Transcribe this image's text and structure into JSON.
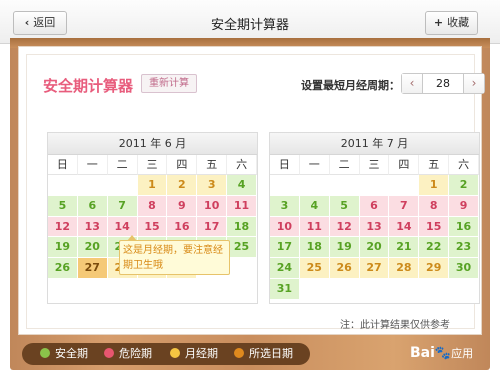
{
  "topbar": {
    "back_label": "返回",
    "back_icon": "‹",
    "title": "安全期计算器",
    "fav_label": "收藏",
    "fav_icon": "+"
  },
  "app": {
    "title": "安全期计算器",
    "recalc_label": "重新计算",
    "cycle_label": "设置最短月经周期：",
    "cycle_prev": "‹",
    "cycle_value": "28",
    "cycle_next": "›"
  },
  "weekdays": [
    "日",
    "一",
    "二",
    "三",
    "四",
    "五",
    "六"
  ],
  "calendars": [
    {
      "header": "2011 年 6 月",
      "cells": [
        {
          "d": "",
          "t": "blank"
        },
        {
          "d": "",
          "t": "blank"
        },
        {
          "d": "",
          "t": "blank"
        },
        {
          "d": "1",
          "t": "period"
        },
        {
          "d": "2",
          "t": "period"
        },
        {
          "d": "3",
          "t": "period"
        },
        {
          "d": "4",
          "t": "safe"
        },
        {
          "d": "5",
          "t": "safe"
        },
        {
          "d": "6",
          "t": "safe"
        },
        {
          "d": "7",
          "t": "safe"
        },
        {
          "d": "8",
          "t": "danger"
        },
        {
          "d": "9",
          "t": "danger"
        },
        {
          "d": "10",
          "t": "danger"
        },
        {
          "d": "11",
          "t": "danger"
        },
        {
          "d": "12",
          "t": "danger"
        },
        {
          "d": "13",
          "t": "danger"
        },
        {
          "d": "14",
          "t": "danger"
        },
        {
          "d": "15",
          "t": "danger"
        },
        {
          "d": "16",
          "t": "danger"
        },
        {
          "d": "17",
          "t": "danger"
        },
        {
          "d": "18",
          "t": "safe"
        },
        {
          "d": "19",
          "t": "safe"
        },
        {
          "d": "20",
          "t": "safe"
        },
        {
          "d": "21",
          "t": "safe"
        },
        {
          "d": "22",
          "t": "safe"
        },
        {
          "d": "23",
          "t": "safe"
        },
        {
          "d": "24",
          "t": "safe"
        },
        {
          "d": "25",
          "t": "safe"
        },
        {
          "d": "26",
          "t": "safe"
        },
        {
          "d": "27",
          "t": "selected"
        },
        {
          "d": "28",
          "t": "period"
        },
        {
          "d": "29",
          "t": "period"
        },
        {
          "d": "30",
          "t": "period"
        },
        {
          "d": "",
          "t": "blank"
        },
        {
          "d": "",
          "t": "blank"
        },
        {
          "d": "",
          "t": "blank"
        },
        {
          "d": "",
          "t": "blank"
        },
        {
          "d": "",
          "t": "blank"
        },
        {
          "d": "",
          "t": "blank"
        },
        {
          "d": "",
          "t": "blank"
        },
        {
          "d": "",
          "t": "blank"
        },
        {
          "d": "",
          "t": "blank"
        }
      ]
    },
    {
      "header": "2011 年 7 月",
      "cells": [
        {
          "d": "",
          "t": "blank"
        },
        {
          "d": "",
          "t": "blank"
        },
        {
          "d": "",
          "t": "blank"
        },
        {
          "d": "",
          "t": "blank"
        },
        {
          "d": "",
          "t": "blank"
        },
        {
          "d": "1",
          "t": "period"
        },
        {
          "d": "2",
          "t": "safe"
        },
        {
          "d": "3",
          "t": "safe"
        },
        {
          "d": "4",
          "t": "safe"
        },
        {
          "d": "5",
          "t": "safe"
        },
        {
          "d": "6",
          "t": "danger"
        },
        {
          "d": "7",
          "t": "danger"
        },
        {
          "d": "8",
          "t": "danger"
        },
        {
          "d": "9",
          "t": "danger"
        },
        {
          "d": "10",
          "t": "danger"
        },
        {
          "d": "11",
          "t": "danger"
        },
        {
          "d": "12",
          "t": "danger"
        },
        {
          "d": "13",
          "t": "danger"
        },
        {
          "d": "14",
          "t": "danger"
        },
        {
          "d": "15",
          "t": "danger"
        },
        {
          "d": "16",
          "t": "safe"
        },
        {
          "d": "17",
          "t": "safe"
        },
        {
          "d": "18",
          "t": "safe"
        },
        {
          "d": "19",
          "t": "safe"
        },
        {
          "d": "20",
          "t": "safe"
        },
        {
          "d": "21",
          "t": "safe"
        },
        {
          "d": "22",
          "t": "safe"
        },
        {
          "d": "23",
          "t": "safe"
        },
        {
          "d": "24",
          "t": "safe"
        },
        {
          "d": "25",
          "t": "period"
        },
        {
          "d": "26",
          "t": "period"
        },
        {
          "d": "27",
          "t": "period"
        },
        {
          "d": "28",
          "t": "period"
        },
        {
          "d": "29",
          "t": "period"
        },
        {
          "d": "30",
          "t": "safe"
        },
        {
          "d": "31",
          "t": "safe"
        },
        {
          "d": "",
          "t": "blank"
        },
        {
          "d": "",
          "t": "blank"
        },
        {
          "d": "",
          "t": "blank"
        },
        {
          "d": "",
          "t": "blank"
        },
        {
          "d": "",
          "t": "blank"
        },
        {
          "d": "",
          "t": "blank"
        }
      ]
    }
  ],
  "tooltip": "这是月经期，要注意经期卫生哦",
  "note": "注：此计算结果仅供参考",
  "legend": [
    {
      "label": "安全期",
      "color": "#8bc34a"
    },
    {
      "label": "危险期",
      "color": "#e8566f"
    },
    {
      "label": "月经期",
      "color": "#f5c542"
    },
    {
      "label": "所选日期",
      "color": "#e08a1e"
    }
  ],
  "brand": {
    "name": "Bai",
    "paw": "🐾",
    "sub": "应用"
  }
}
